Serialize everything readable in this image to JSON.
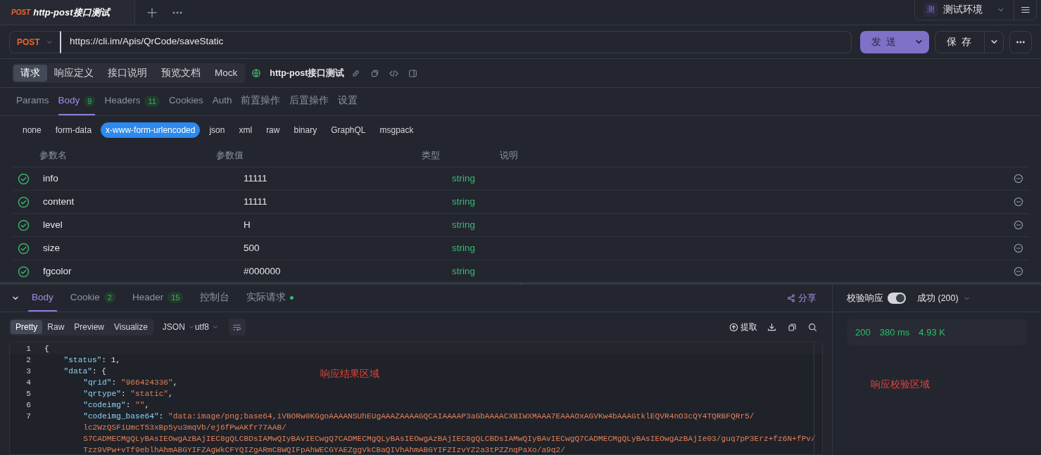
{
  "top_tab": {
    "method": "POST",
    "title": "http-post接口测试",
    "selected": true
  },
  "environment": {
    "badge": "测",
    "name": "测试环境"
  },
  "request": {
    "method": "POST",
    "url": "https://cli.im/Apis/QrCode/saveStatic",
    "send_label": "发 送",
    "save_label": "保 存"
  },
  "view_tabs": [
    {
      "label": "请求",
      "selected": true
    },
    {
      "label": "响应定义",
      "selected": false
    },
    {
      "label": "接口说明",
      "selected": false
    },
    {
      "label": "预览文档",
      "selected": false
    },
    {
      "label": "Mock",
      "selected": false
    }
  ],
  "api_name": "http-post接口测试",
  "request_tabs": [
    {
      "label": "Params",
      "selected": false
    },
    {
      "label": "Body",
      "count": "9",
      "selected": true
    },
    {
      "label": "Headers",
      "count": "11",
      "selected": false
    },
    {
      "label": "Cookies",
      "selected": false
    },
    {
      "label": "Auth",
      "selected": false
    },
    {
      "label": "前置操作",
      "selected": false
    },
    {
      "label": "后置操作",
      "selected": false
    },
    {
      "label": "设置",
      "selected": false
    }
  ],
  "body_types": [
    {
      "label": "none",
      "selected": false
    },
    {
      "label": "form-data",
      "selected": false
    },
    {
      "label": "x-www-form-urlencoded",
      "selected": true
    },
    {
      "label": "json",
      "selected": false
    },
    {
      "label": "xml",
      "selected": false
    },
    {
      "label": "raw",
      "selected": false
    },
    {
      "label": "binary",
      "selected": false
    },
    {
      "label": "GraphQL",
      "selected": false
    },
    {
      "label": "msgpack",
      "selected": false
    }
  ],
  "params_table": {
    "columns": [
      "参数名",
      "参数值",
      "类型",
      "说明"
    ],
    "rows": [
      {
        "checked": true,
        "name": "info",
        "value": "11111",
        "type": "string"
      },
      {
        "checked": true,
        "name": "content",
        "value": "11111",
        "type": "string"
      },
      {
        "checked": true,
        "name": "level",
        "value": "H",
        "type": "string"
      },
      {
        "checked": true,
        "name": "size",
        "value": "500",
        "type": "string"
      },
      {
        "checked": true,
        "name": "fgcolor",
        "value": "#000000",
        "type": "string"
      }
    ]
  },
  "response_tabs": [
    {
      "label": "Body",
      "selected": true
    },
    {
      "label": "Cookie",
      "count": "2",
      "selected": false
    },
    {
      "label": "Header",
      "count": "15",
      "selected": false
    },
    {
      "label": "控制台",
      "selected": false
    },
    {
      "label": "实际请求",
      "dot": true,
      "selected": false
    }
  ],
  "share_label": "分享",
  "format_tabs": [
    {
      "label": "Pretty",
      "selected": true
    },
    {
      "label": "Raw",
      "selected": false
    },
    {
      "label": "Preview",
      "selected": false
    },
    {
      "label": "Visualize",
      "selected": false
    }
  ],
  "format": "JSON",
  "encoding": "utf8",
  "extract_label": "提取",
  "code_lines": [
    {
      "number": "1",
      "tokens": [
        {
          "kind": "punct",
          "text": "{"
        }
      ],
      "children": [
        {
          "number": "2",
          "tokens": [
            {
              "kind": "key",
              "text": "\"status\""
            },
            {
              "kind": "punct",
              "text": ": "
            },
            {
              "kind": "number",
              "text": "1"
            },
            {
              "kind": "punct",
              "text": ","
            }
          ]
        },
        {
          "number": "3",
          "tokens": [
            {
              "kind": "key",
              "text": "\"data\""
            },
            {
              "kind": "punct",
              "text": ": {"
            }
          ],
          "children": [
            {
              "number": "4",
              "tokens": [
                {
                  "kind": "key",
                  "text": "\"qrid\""
                },
                {
                  "kind": "punct",
                  "text": ": "
                },
                {
                  "kind": "string",
                  "text": "\"966424336\""
                },
                {
                  "kind": "punct",
                  "text": ","
                }
              ]
            },
            {
              "number": "5",
              "tokens": [
                {
                  "kind": "key",
                  "text": "\"qrtype\""
                },
                {
                  "kind": "punct",
                  "text": ": "
                },
                {
                  "kind": "string",
                  "text": "\"static\""
                },
                {
                  "kind": "punct",
                  "text": ","
                }
              ]
            },
            {
              "number": "6",
              "tokens": [
                {
                  "kind": "key",
                  "text": "\"codeimg\""
                },
                {
                  "kind": "punct",
                  "text": ": "
                },
                {
                  "kind": "string",
                  "text": "\"\""
                },
                {
                  "kind": "punct",
                  "text": ","
                }
              ]
            },
            {
              "number": "7",
              "tokens": [
                {
                  "kind": "key",
                  "text": "\"codeimg_base64\""
                },
                {
                  "kind": "punct",
                  "text": ": "
                },
                {
                  "kind": "string",
                  "text": "\"data:image/png;base64,iVBORw0KGgoAAAANSUhEUgAAAZAAAAGQCAIAAAAP3aGbAAAACXBIWXMAAA7EAAAOxAGVKw4bAAAGtklEQVR4nO3cQY4TQRBFQRr5/"
                }
              ],
              "wrapped": [
                "lc2WzQSFiUmcT53xBp5yu3mqVb/ej6fPwAKfr77AAB/",
                "S7CADMECMgQLyBAsIEOwgAzBAjIEC8gQLCBDsIAMwQIyBAvIECwgQ7CADMECMgQLyBAsIEOwgAzBAjIEC8gQLCBDsIAMwQIyBAvIECwgQ7CADMECMgQLyBAsIEOwgAzBAjIe03/guq7pP3Erz+fz6N+fPv/",
                "Tzz9VPw+vTf9eblhAhmABGYIFZAgWkCFYQIZgARmCBWQIFpAhWECGYAEZggVkCBaQIVhAhmABGYIFZIzvYZ2a3tPZZnqPaXo/a9q2/"
              ]
            }
          ]
        }
      ]
    }
  ],
  "result_annotation": "响应结果区域",
  "validation": {
    "label": "校验响应",
    "on": true,
    "result": "成功 (200)",
    "status_code": "200",
    "time": "380 ms",
    "size": "4.93 K",
    "annotation": "响应校验区域"
  }
}
